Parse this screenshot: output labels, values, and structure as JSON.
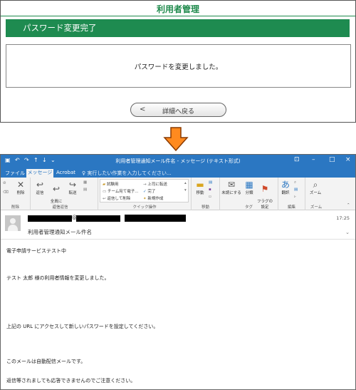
{
  "web": {
    "app_title": "利用者管理",
    "page_header": "パスワード変更完了",
    "message": "パスワードを変更しました。",
    "back_chevron": "<",
    "back_button_label": "詳細へ戻る",
    "accent_color": "#1e8b50"
  },
  "outlook": {
    "window_title": "利用者管理通知メール件名 - メッセージ (テキスト形式)",
    "quick_access": [
      "save-icon",
      "undo-icon",
      "redo-icon",
      "up-arrow-icon",
      "down-arrow-icon",
      "customize-icon"
    ],
    "window_controls": [
      "–",
      "□",
      "×"
    ],
    "window_options_glyph": "⊡",
    "tabs": {
      "file": "ファイル",
      "message": "メッセージ",
      "acrobat": "Acrobat",
      "tell_me": "実行したい作業を入力してください..."
    },
    "ribbon": {
      "delete_group": {
        "label": "削除",
        "delete": "削除"
      },
      "respond_group": {
        "label": "返信",
        "reply": "返信",
        "reply_all": "全員に\n返信",
        "forward": "転送"
      },
      "quick_steps": {
        "label": "クイック操作",
        "items": [
          "試験用",
          "チーム宛て電子...",
          "返信して削除",
          "上司に転送",
          "完了",
          "新規作成"
        ]
      },
      "move_group": {
        "label": "移動",
        "move": "移動"
      },
      "tags_group": {
        "label": "タグ",
        "unread": "未読にする",
        "categorize": "分類",
        "follow_up": "フラグの\n設定"
      },
      "editing_group": {
        "label": "編集",
        "translate": "翻訳"
      },
      "zoom_group": {
        "label": "ズーム",
        "zoom": "ズーム"
      }
    },
    "header": {
      "at": "@",
      "subject": "利用者管理通知メール件名",
      "time": "17:25"
    },
    "body_lines": [
      "電子申請サービステスト中",
      "テスト 太郎 様の利用者情報を変更しました。",
      "上記の URL にアクセスして新しいパスワードを設定してください。",
      "このメールは自動配信メールです。",
      "返信等されましても応答できませんのでご注意ください。"
    ],
    "title_color": "#2b77c2"
  }
}
